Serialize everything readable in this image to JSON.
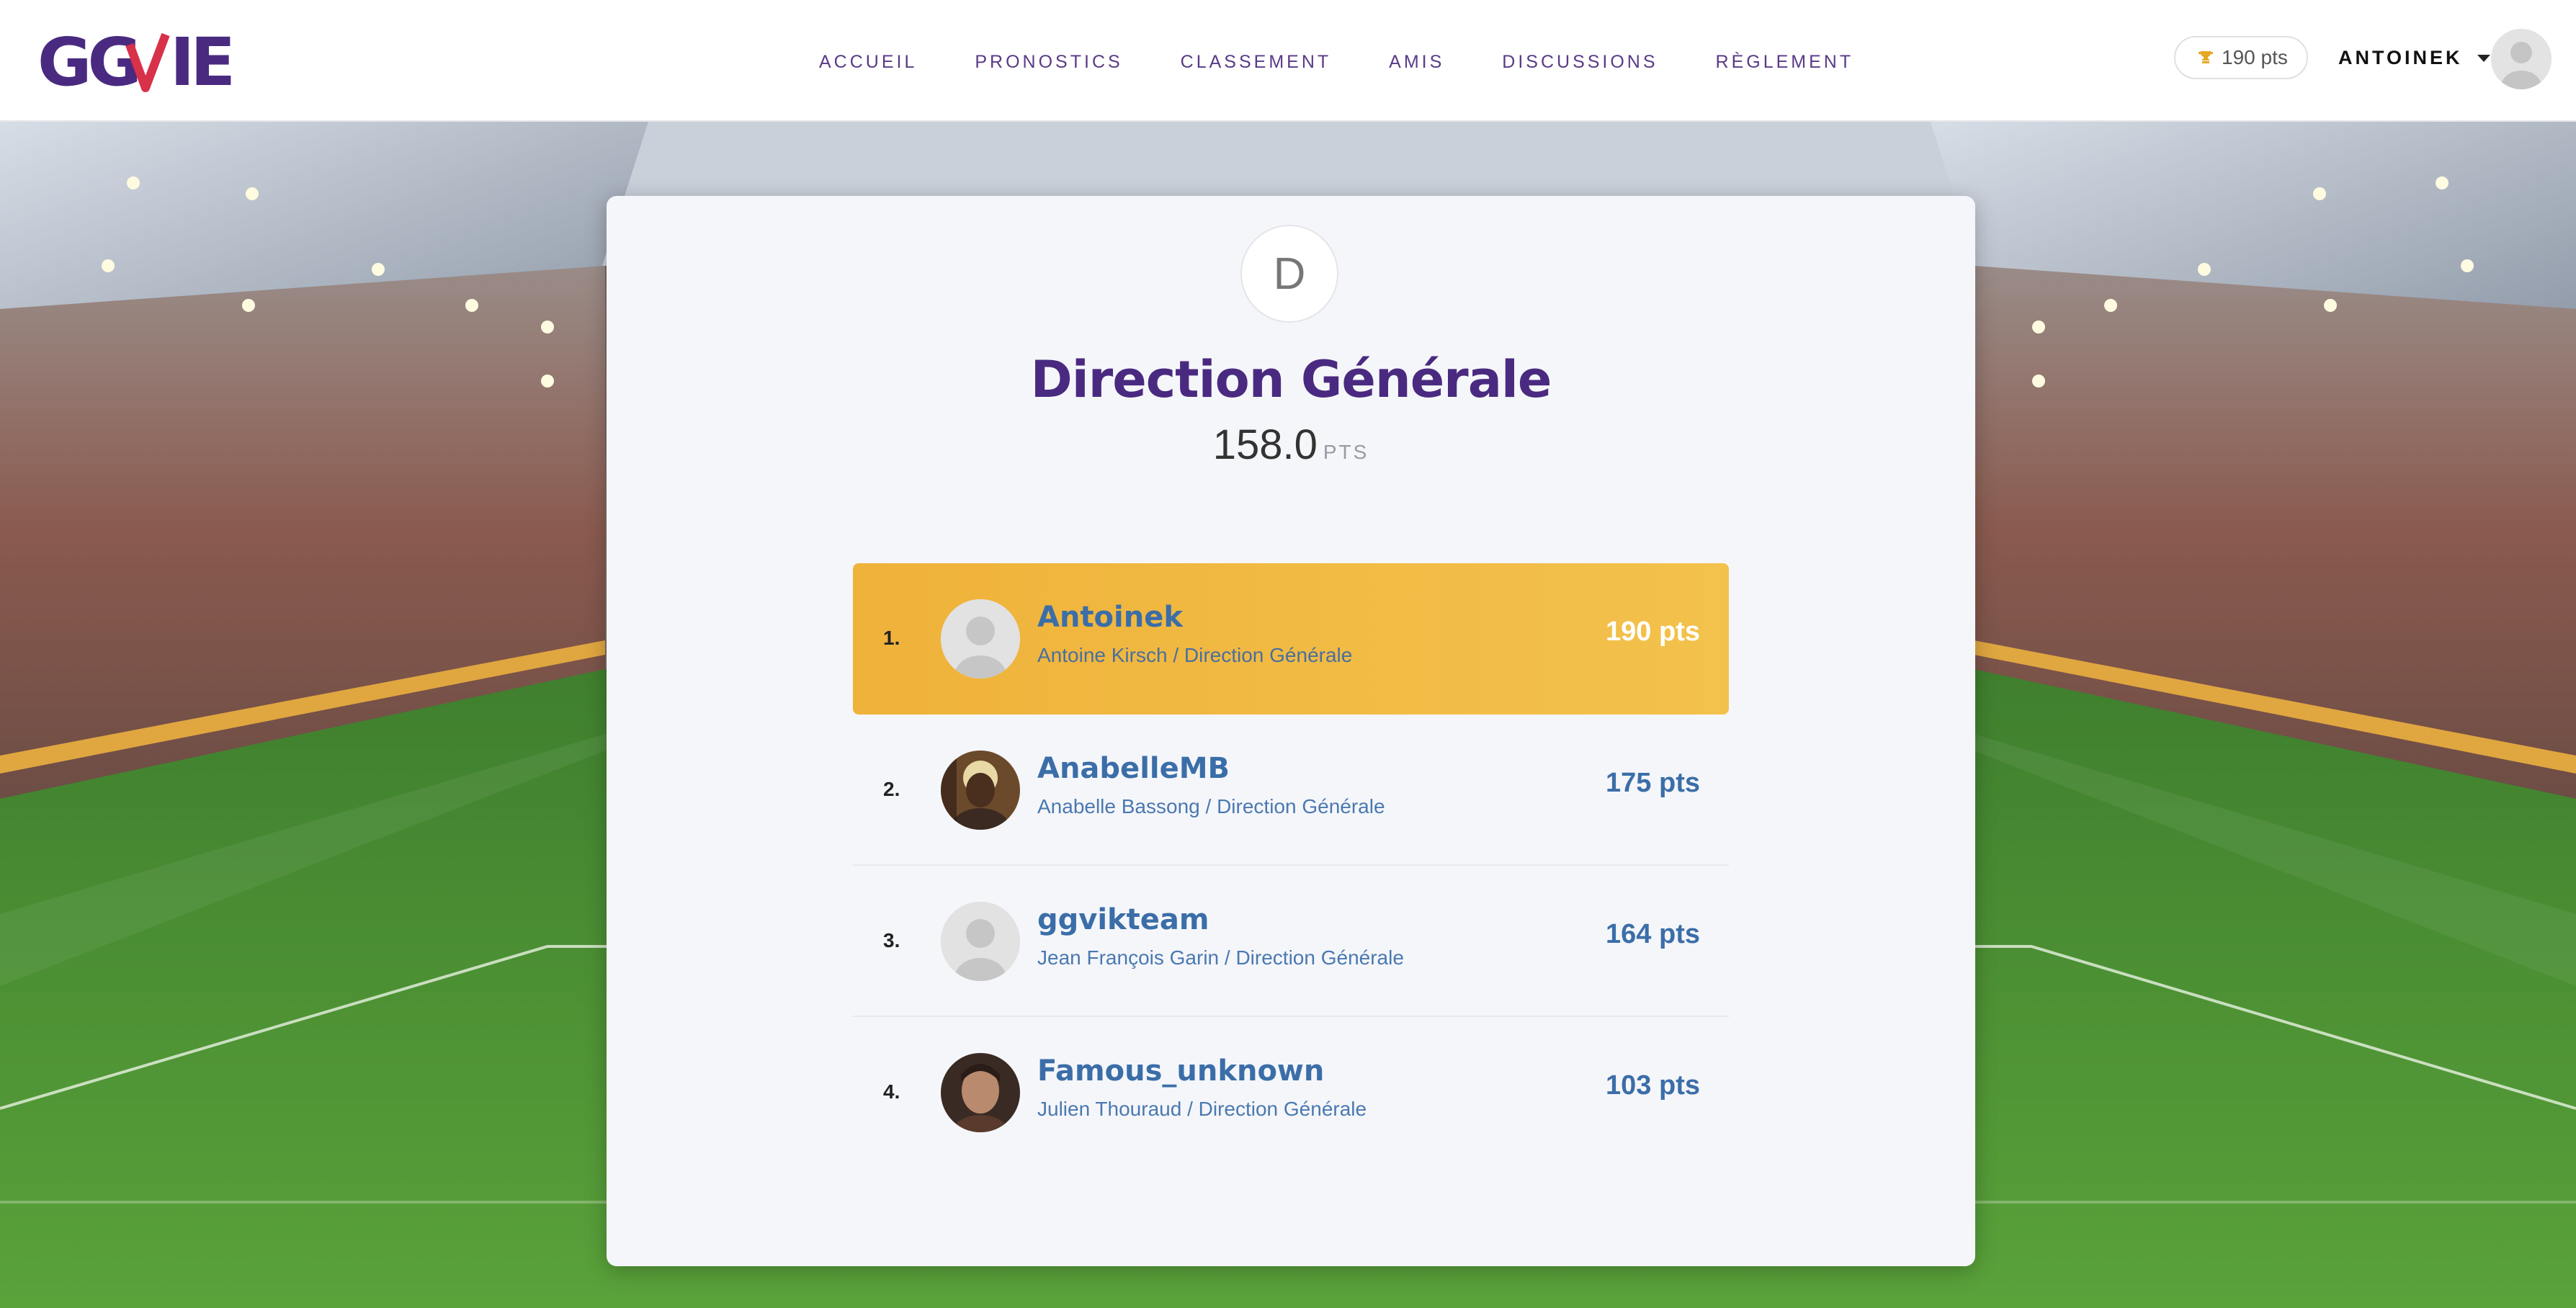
{
  "header": {
    "logo_text": "GGVIE",
    "nav": [
      "ACCUEIL",
      "PRONOSTICS",
      "CLASSEMENT",
      "AMIS",
      "DISCUSSIONS",
      "RÈGLEMENT"
    ],
    "points_badge": "190 pts",
    "username": "ANTOINEK"
  },
  "team": {
    "initial": "D",
    "name": "Direction Générale",
    "score": "158.0",
    "score_unit": "PTS"
  },
  "ranking": [
    {
      "rank": "1.",
      "username": "Antoinek",
      "fullname": "Antoine Kirsch",
      "team": "Direction Générale",
      "points": "190 pts",
      "highlight": true,
      "avatar": "default-avatar-icon"
    },
    {
      "rank": "2.",
      "username": "AnabelleMB",
      "fullname": "Anabelle Bassong",
      "team": "Direction Générale",
      "points": "175 pts",
      "highlight": false,
      "avatar": "photo"
    },
    {
      "rank": "3.",
      "username": "ggvikteam",
      "fullname": "Jean François Garin",
      "team": "Direction Générale",
      "points": "164 pts",
      "highlight": false,
      "avatar": "default-avatar-icon"
    },
    {
      "rank": "4.",
      "username": "Famous_unknown",
      "fullname": "Julien Thouraud",
      "team": "Direction Générale",
      "points": "103 pts",
      "highlight": false,
      "avatar": "photo"
    }
  ],
  "colors": {
    "brand_purple": "#4a2a80",
    "brand_red": "#d8314a",
    "highlight_gold": "#f0b63f",
    "link_blue": "#3b6ea8"
  }
}
